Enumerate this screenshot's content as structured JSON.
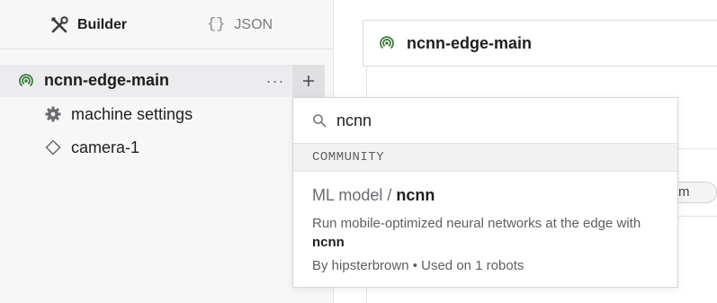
{
  "tabs": {
    "builder_label": "Builder",
    "json_icon": "{}",
    "json_label": "JSON"
  },
  "tree": {
    "root_label": "ncnn-edge-main",
    "more_label": "···",
    "add_label": "+",
    "items": [
      {
        "label": "machine settings",
        "icon": "gear-icon"
      },
      {
        "label": "camera-1",
        "icon": "diamond-icon"
      }
    ]
  },
  "machine": {
    "title": "ncnn-edge-main",
    "partial_chip": "m"
  },
  "dropdown": {
    "search_value": "ncnn",
    "section": "COMMUNITY",
    "result": {
      "type_prefix": "ML model / ",
      "name": "ncnn",
      "desc_prefix": "Run mobile-optimized neural networks at the edge with ",
      "desc_highlight": "ncnn",
      "meta": "By hipsterbrown • Used on 1 robots"
    }
  },
  "colors": {
    "status_green": "#3d7d3f",
    "accent_text": "#1f1f1f"
  }
}
